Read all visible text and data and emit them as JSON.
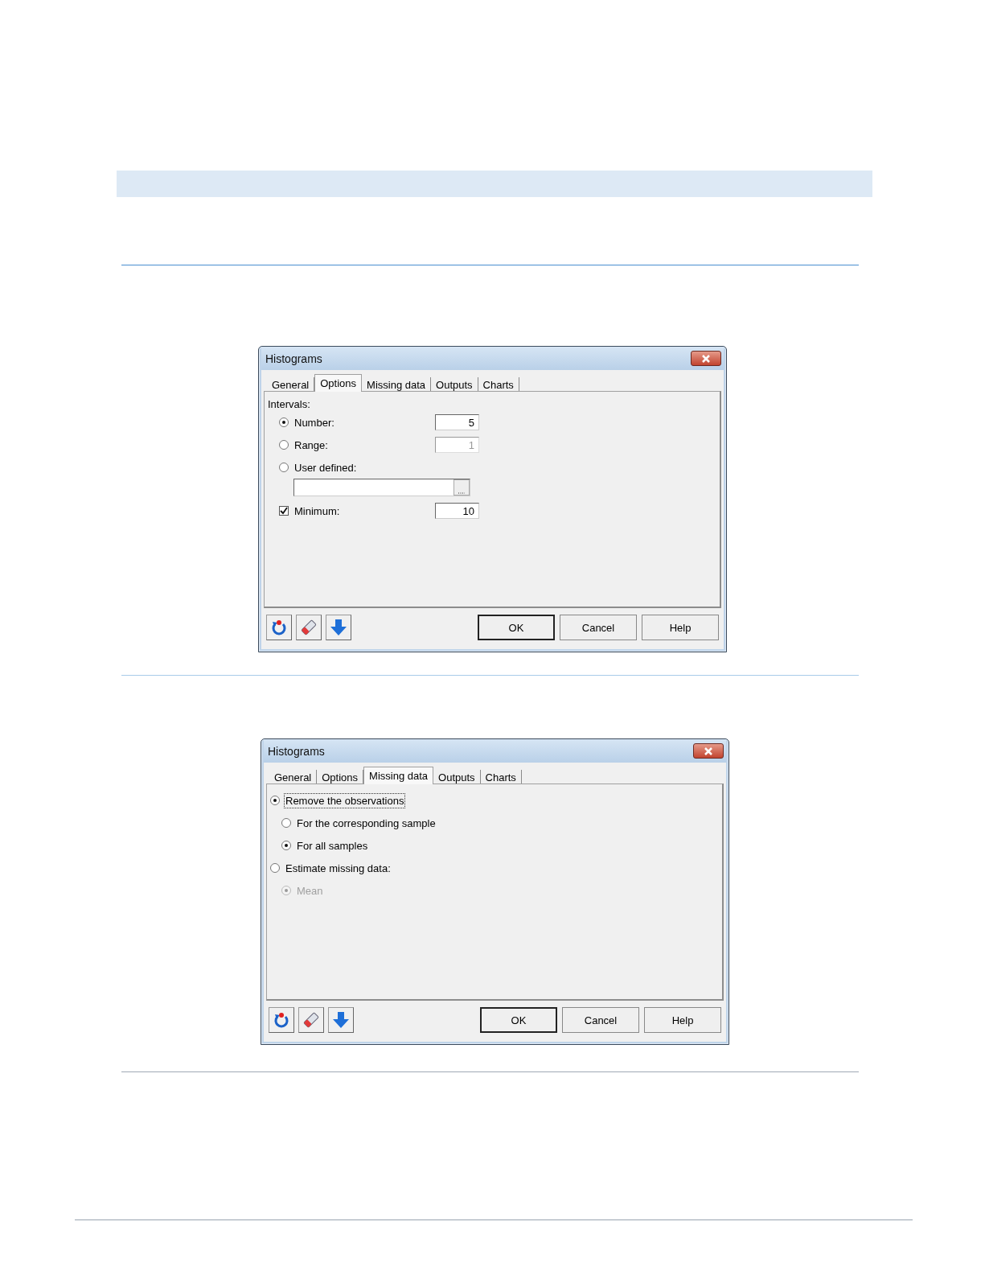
{
  "dialogs": [
    {
      "title": "Histograms",
      "tabs": [
        {
          "label": "General",
          "selected": false
        },
        {
          "label": "Options",
          "selected": true
        },
        {
          "label": "Missing data",
          "selected": false
        },
        {
          "label": "Outputs",
          "selected": false
        },
        {
          "label": "Charts",
          "selected": false
        }
      ],
      "controls": [
        {
          "kind": "label",
          "label": "Intervals:",
          "children": [
            {
              "kind": "radio",
              "label": "Number:",
              "selected": true,
              "field": {
                "value": "5",
                "disabled": false
              }
            },
            {
              "kind": "radio",
              "label": "Range:",
              "selected": false,
              "field": {
                "value": "1",
                "disabled": true
              }
            },
            {
              "kind": "radio",
              "label": "User defined:",
              "selected": false,
              "children": [
                {
                  "kind": "range-field"
                }
              ]
            },
            {
              "kind": "checkbox",
              "label": "Minimum:",
              "checked": true,
              "field": {
                "value": "10",
                "disabled": false
              }
            }
          ]
        }
      ],
      "buttons": [
        {
          "label": "OK",
          "default": true
        },
        {
          "label": "Cancel",
          "default": false
        },
        {
          "label": "Help",
          "default": false
        }
      ]
    },
    {
      "title": "Histograms",
      "tabs": [
        {
          "label": "General",
          "selected": false
        },
        {
          "label": "Options",
          "selected": false
        },
        {
          "label": "Missing data",
          "selected": true
        },
        {
          "label": "Outputs",
          "selected": false
        },
        {
          "label": "Charts",
          "selected": false
        }
      ],
      "controls": [
        {
          "kind": "radio",
          "label": "Remove the observations",
          "selected": true,
          "focused": true,
          "children": [
            {
              "kind": "radio",
              "label": "For the corresponding sample",
              "selected": false
            },
            {
              "kind": "radio",
              "label": "For all samples",
              "selected": true
            }
          ]
        },
        {
          "kind": "radio",
          "label": "Estimate missing data:",
          "selected": false,
          "children": [
            {
              "kind": "radio",
              "label": "Mean",
              "selected": true,
              "disabled": true
            }
          ]
        }
      ],
      "buttons": [
        {
          "label": "OK",
          "default": true
        },
        {
          "label": "Cancel",
          "default": false
        },
        {
          "label": "Help",
          "default": false
        }
      ]
    }
  ]
}
